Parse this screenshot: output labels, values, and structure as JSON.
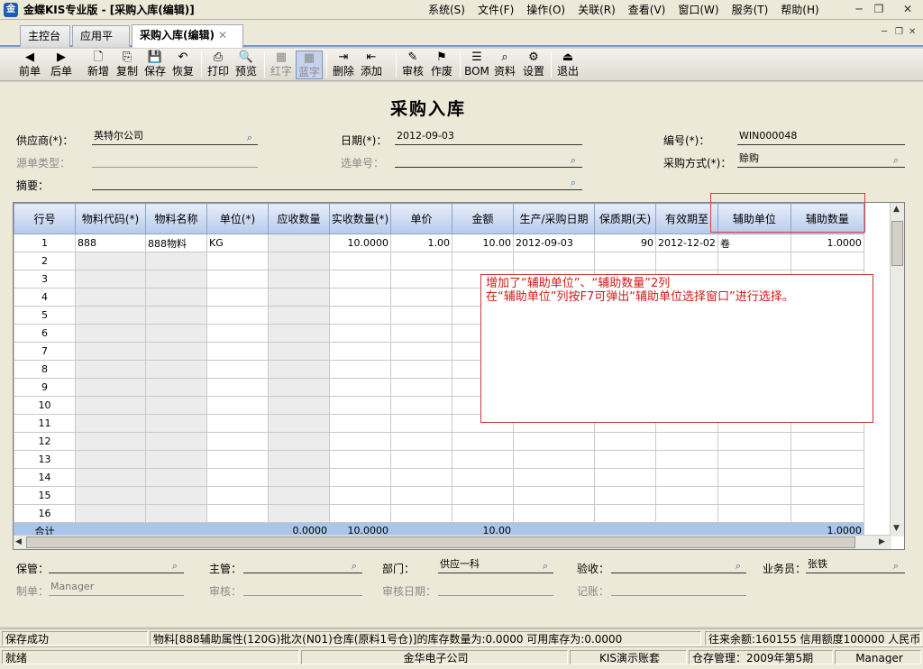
{
  "window": {
    "title": "金蝶KIS专业版 - [采购入库(编辑)]",
    "icon_letter": "金",
    "min_glyph": "─",
    "restore_glyph": "❐",
    "close_glyph": "✕"
  },
  "menu": [
    "系统(S)",
    "文件(F)",
    "操作(O)",
    "关联(R)",
    "查看(V)",
    "窗口(W)",
    "服务(T)",
    "帮助(H)"
  ],
  "tabs": [
    {
      "label": "主控台"
    },
    {
      "label": "应用平台"
    },
    {
      "label": "采购入库(编辑)",
      "close": "✕"
    }
  ],
  "toolbar": [
    {
      "label": "前单",
      "icon": "◀"
    },
    {
      "label": "后单",
      "icon": "▶"
    },
    {
      "label": "新增",
      "icon": "🗋"
    },
    {
      "label": "复制",
      "icon": "⎘"
    },
    {
      "label": "保存",
      "icon": "💾"
    },
    {
      "label": "恢复",
      "icon": "↶"
    },
    {
      "label": "打印",
      "icon": "⎙"
    },
    {
      "label": "预览",
      "icon": "🔍"
    },
    {
      "label": "红字",
      "icon": "▦"
    },
    {
      "label": "蓝字",
      "icon": "▦"
    },
    {
      "label": "删除",
      "icon": "⇥"
    },
    {
      "label": "添加",
      "icon": "⇤"
    },
    {
      "label": "审核",
      "icon": "✎"
    },
    {
      "label": "作废",
      "icon": "⚑"
    },
    {
      "label": "BOM",
      "icon": "☰"
    },
    {
      "label": "资料",
      "icon": "⌕"
    },
    {
      "label": "设置",
      "icon": "⚙"
    },
    {
      "label": "退出",
      "icon": "⏏"
    }
  ],
  "document": {
    "title": "采购入库",
    "fields": {
      "supplier_label": "供应商(*)：",
      "supplier_value": "英特尔公司",
      "date_label": "日期(*)：",
      "date_value": "2012-09-03",
      "number_label": "编号(*)：",
      "number_value": "WIN000048",
      "source_type_label": "源单类型：",
      "source_type_value": "",
      "select_no_label": "选单号：",
      "select_no_value": "",
      "purchase_method_label": "采购方式(*)：",
      "purchase_method_value": "赊购",
      "summary_label": "摘要：",
      "summary_value": ""
    },
    "footer": {
      "keeper_label": "保管：",
      "supervisor_label": "主管：",
      "department_label": "部门：",
      "department_value": "供应一科",
      "inspect_label": "验收：",
      "salesman_label": "业务员：",
      "salesman_value": "张铁",
      "maker_label": "制单：",
      "maker_value": "Manager",
      "reviewer_label": "审核：",
      "review_date_label": "审核日期：",
      "post_label": "记账："
    }
  },
  "grid": {
    "columns": [
      "行号",
      "物料代码(*)",
      "物料名称",
      "单位(*)",
      "应收数量",
      "实收数量(*)",
      "单价",
      "金额",
      "生产/采购日期",
      "保质期(天)",
      "有效期至",
      "辅助单位",
      "辅助数量"
    ],
    "rows": [
      [
        "1",
        "888",
        "888物料",
        "KG",
        "",
        "10.0000",
        "1.00",
        "10.00",
        "2012-09-03",
        "90",
        "2012-12-02",
        "卷",
        "1.0000"
      ],
      [
        "2",
        "",
        "",
        "",
        "",
        "",
        "",
        "",
        "",
        "",
        "",
        "",
        ""
      ],
      [
        "3",
        "",
        "",
        "",
        "",
        "",
        "",
        "",
        "",
        "",
        "",
        "",
        ""
      ],
      [
        "4",
        "",
        "",
        "",
        "",
        "",
        "",
        "",
        "",
        "",
        "",
        "",
        ""
      ],
      [
        "5",
        "",
        "",
        "",
        "",
        "",
        "",
        "",
        "",
        "",
        "",
        "",
        ""
      ],
      [
        "6",
        "",
        "",
        "",
        "",
        "",
        "",
        "",
        "",
        "",
        "",
        "",
        ""
      ],
      [
        "7",
        "",
        "",
        "",
        "",
        "",
        "",
        "",
        "",
        "",
        "",
        "",
        ""
      ],
      [
        "8",
        "",
        "",
        "",
        "",
        "",
        "",
        "",
        "",
        "",
        "",
        "",
        ""
      ],
      [
        "9",
        "",
        "",
        "",
        "",
        "",
        "",
        "",
        "",
        "",
        "",
        "",
        ""
      ],
      [
        "10",
        "",
        "",
        "",
        "",
        "",
        "",
        "",
        "",
        "",
        "",
        "",
        ""
      ],
      [
        "11",
        "",
        "",
        "",
        "",
        "",
        "",
        "",
        "",
        "",
        "",
        "",
        ""
      ],
      [
        "12",
        "",
        "",
        "",
        "",
        "",
        "",
        "",
        "",
        "",
        "",
        "",
        ""
      ],
      [
        "13",
        "",
        "",
        "",
        "",
        "",
        "",
        "",
        "",
        "",
        "",
        "",
        ""
      ],
      [
        "14",
        "",
        "",
        "",
        "",
        "",
        "",
        "",
        "",
        "",
        "",
        "",
        ""
      ],
      [
        "15",
        "",
        "",
        "",
        "",
        "",
        "",
        "",
        "",
        "",
        "",
        "",
        ""
      ],
      [
        "16",
        "",
        "",
        "",
        "",
        "",
        "",
        "",
        "",
        "",
        "",
        "",
        ""
      ]
    ],
    "total": [
      "合计",
      "",
      "",
      "",
      "0.0000",
      "10.0000",
      "",
      "10.00",
      "",
      "",
      "",
      "",
      "1.0000"
    ]
  },
  "annotation": {
    "line1": "增加了“辅助单位”、“辅助数量”2列",
    "line2": "在“辅助单位”列按F7可弹出“辅助单位选择窗口”进行选择。"
  },
  "status": {
    "message": "保存成功",
    "stock_info": "物料[888辅助属性(120G)批次(N01)仓库(原料1号仓)]的库存数量为:0.0000    可用库存为:0.0000",
    "credit_info": "往来余额:160155 信用额度100000 人民币",
    "ready": "就绪",
    "company": "金华电子公司",
    "account_set": "KIS演示账套",
    "period": "仓存管理：2009年第5期",
    "user": "Manager"
  },
  "colors": {
    "annotation_red": "#d21a1a",
    "total_row_blue": "#a9c6ea",
    "grid_header_blue": "#b7caea"
  }
}
